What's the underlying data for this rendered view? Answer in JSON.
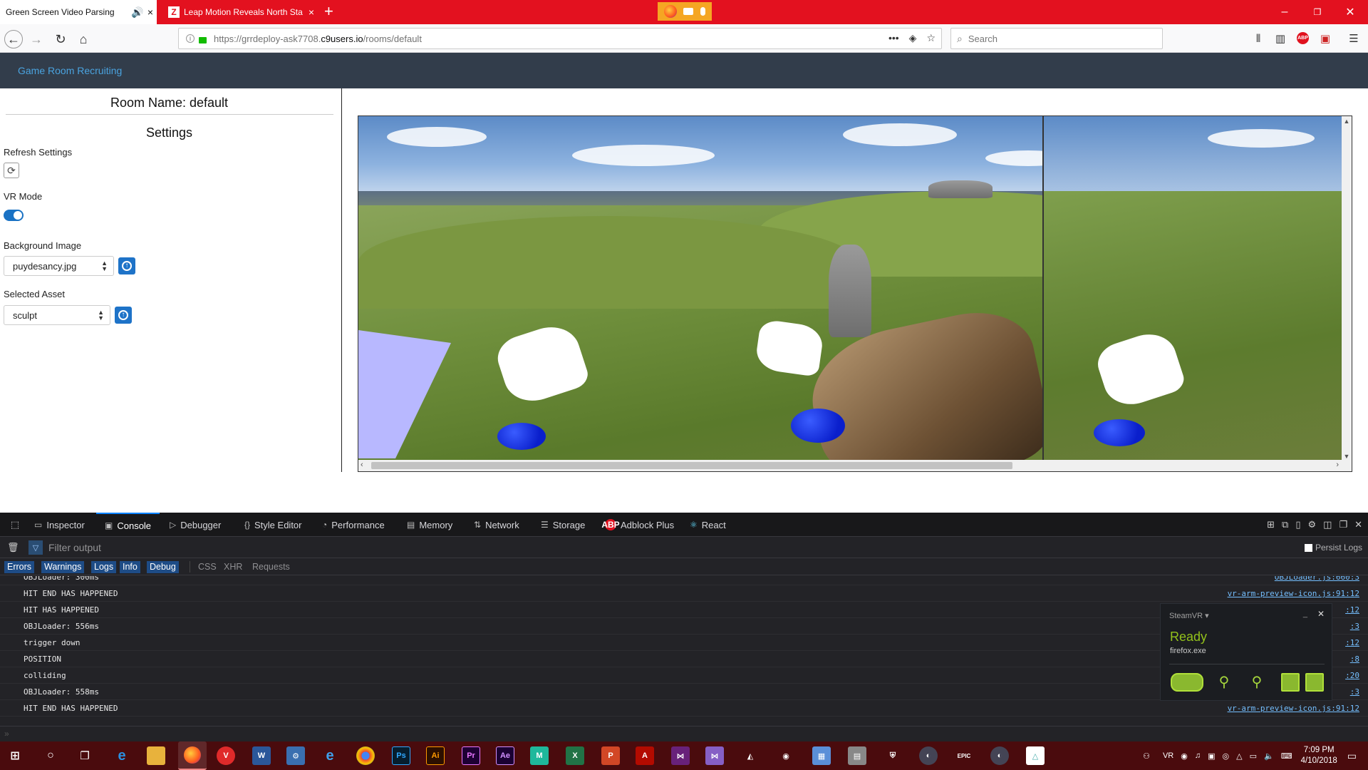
{
  "browser": {
    "tabs": [
      {
        "title": "Green Screen Video Parsing",
        "active": true
      },
      {
        "title": "Leap Motion Reveals North Sta",
        "favicon": "Z",
        "active": false
      }
    ],
    "url": {
      "prefix": "https://grrdeploy-ask7708.",
      "host": "c9users.io",
      "path": "/rooms/default"
    },
    "search_placeholder": "Search",
    "accent_color": "#e3111f"
  },
  "page": {
    "brand": "Game Room Recruiting",
    "room_name": "Room Name: default",
    "settings_title": "Settings",
    "refresh_label": "Refresh Settings",
    "vr_mode_label": "VR Mode",
    "vr_mode_on": true,
    "background_label": "Background Image",
    "background_value": "puydesancy.jpg",
    "asset_label": "Selected Asset",
    "asset_value": "sculpt"
  },
  "devtools": {
    "tabs": [
      {
        "label": "Inspector",
        "icon": "inspector-icon"
      },
      {
        "label": "Console",
        "icon": "console-icon",
        "selected": true
      },
      {
        "label": "Debugger",
        "icon": "debugger-icon"
      },
      {
        "label": "Style Editor",
        "icon": "style-editor-icon"
      },
      {
        "label": "Performance",
        "icon": "performance-icon"
      },
      {
        "label": "Memory",
        "icon": "memory-icon"
      },
      {
        "label": "Network",
        "icon": "network-icon"
      },
      {
        "label": "Storage",
        "icon": "storage-icon"
      },
      {
        "label": "Adblock Plus",
        "icon": "abp-icon"
      },
      {
        "label": "React",
        "icon": "react-icon"
      }
    ],
    "filter_placeholder": "Filter output",
    "persist_logs": "Persist Logs",
    "levels": [
      "Errors",
      "Warnings",
      "Logs",
      "Info",
      "Debug"
    ],
    "types": [
      "CSS",
      "XHR",
      "Requests"
    ],
    "logs": [
      {
        "msg": "OBJLoader: 300ms",
        "src": "OBJLoader.js:660:3"
      },
      {
        "msg": "HIT END HAS HAPPENED",
        "src": "vr-arm-preview-icon.js:91:12"
      },
      {
        "msg": "HIT HAS HAPPENED",
        "src": ":12"
      },
      {
        "msg": "OBJLoader: 556ms",
        "src": ":3"
      },
      {
        "msg": "trigger down",
        "src": ":12"
      },
      {
        "msg": "POSITION",
        "src": ":8"
      },
      {
        "msg": "colliding",
        "src": ":20"
      },
      {
        "msg": "OBJLoader: 558ms",
        "src": ":3"
      },
      {
        "msg": "HIT END HAS HAPPENED",
        "src": "vr-arm-preview-icon.js:91:12"
      }
    ]
  },
  "steamvr": {
    "title": "SteamVR ▾",
    "status": "Ready",
    "app": "firefox.exe"
  },
  "taskbar": {
    "time": "7:09 PM",
    "date": "4/10/2018"
  }
}
